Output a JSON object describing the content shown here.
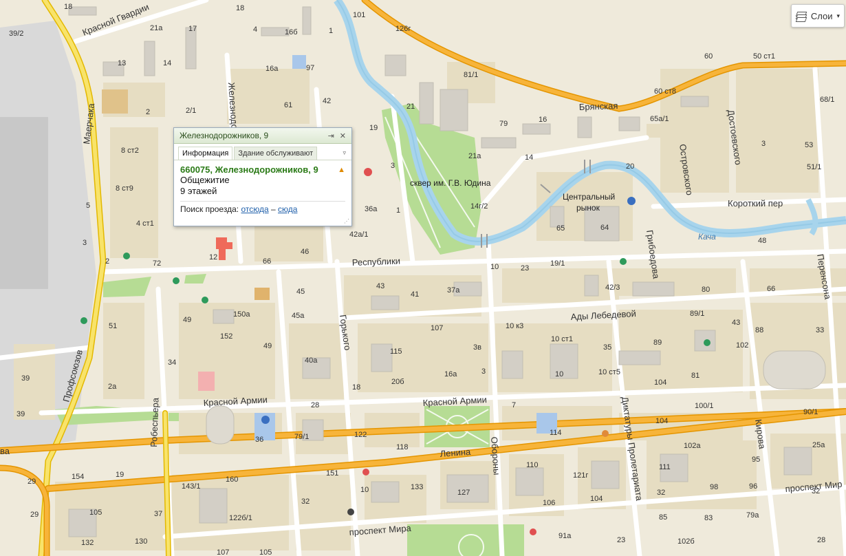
{
  "layers_button": {
    "label": "Слои",
    "icon": "layers-icon"
  },
  "popup": {
    "title": "Железнодорожников, 9",
    "tabs": [
      "Информация",
      "Здание обслуживают"
    ],
    "address": "660075, Железнодорожников, 9",
    "type": "Общежитие",
    "floors": "9 этажей",
    "route_label": "Поиск проезда:",
    "route_from": "отсюда",
    "route_dash": "–",
    "route_to": "сюда"
  },
  "streets": {
    "bryanskaya": "Брянская",
    "respubliki": "Республики",
    "ady_lebedevoy": "Ады Лебедевой",
    "krasnoy_armii_w": "Красной Армии",
    "krasnoy_armii_e": "Красной Армии",
    "lenina": "Ленина",
    "prospekt_mira": "проспект Мира",
    "prospekt_mira_e": "проспект Мир",
    "korotkiy": "Короткий пер",
    "krasnoy_gvardii": "Красной Гвардии",
    "mayerchaka": "Маерчака",
    "profsoyuzov": "Профсоюзов",
    "robespera": "Робеспьера",
    "gorkogo": "Горького",
    "oborony": "Обороны",
    "diktatury": "Диктатуры Пролетариата",
    "kirova": "Кирова",
    "perensona": "Перенсона",
    "griboedova": "Грибоедова",
    "ostrovskogo": "Островского",
    "dostoevskogo": "Достоевского",
    "zheleznodor": "Железнодо",
    "lenina_w": "ва"
  },
  "pois": {
    "park": "сквер им. Г.В. Юдина",
    "market_line1": "Центральный",
    "market_line2": "рынок",
    "river": "Кача"
  },
  "house_numbers": [
    "18",
    "18",
    "4",
    "16б",
    "1",
    "21а",
    "17",
    "14",
    "13",
    "2",
    "2/1",
    "61",
    "42",
    "16а",
    "97",
    "8 ст2",
    "8 ст9",
    "5",
    "4 ст1",
    "3",
    "2",
    "72",
    "12",
    "66",
    "46",
    "36а",
    "3",
    "1",
    "42а/1",
    "19",
    "21",
    "81/1",
    "79",
    "16",
    "14",
    "21а",
    "14г/2",
    "20",
    "65",
    "64",
    "60",
    "50 ст1",
    "60 ст8",
    "65а/1",
    "68/1",
    "3",
    "53",
    "51/1",
    "48",
    "10",
    "23",
    "19/1",
    "43",
    "41",
    "37а",
    "42/3",
    "80",
    "89/1",
    "66",
    "45",
    "45а",
    "49",
    "150а",
    "152",
    "49",
    "107",
    "115",
    "20б",
    "3в",
    "3",
    "16а",
    "10 к3",
    "10 ст1",
    "35",
    "10 ст5",
    "10",
    "89",
    "102",
    "43",
    "88",
    "33",
    "51",
    "39",
    "39",
    "34",
    "2а",
    "40а",
    "18",
    "28",
    "122",
    "118",
    "7",
    "114",
    "104",
    "100/1",
    "90/1",
    "104",
    "81",
    "79/1",
    "36",
    "19",
    "154",
    "160",
    "143/1",
    "151",
    "133",
    "127",
    "110",
    "121г",
    "104",
    "102а",
    "111",
    "32",
    "98",
    "96",
    "95",
    "25а",
    "32",
    "29",
    "105",
    "37",
    "122б/1",
    "32",
    "10",
    "106",
    "85",
    "83",
    "79а",
    "29",
    "132",
    "130",
    "107",
    "105",
    "91а",
    "23",
    "102б",
    "28",
    "39/2",
    "101",
    "126г"
  ]
}
